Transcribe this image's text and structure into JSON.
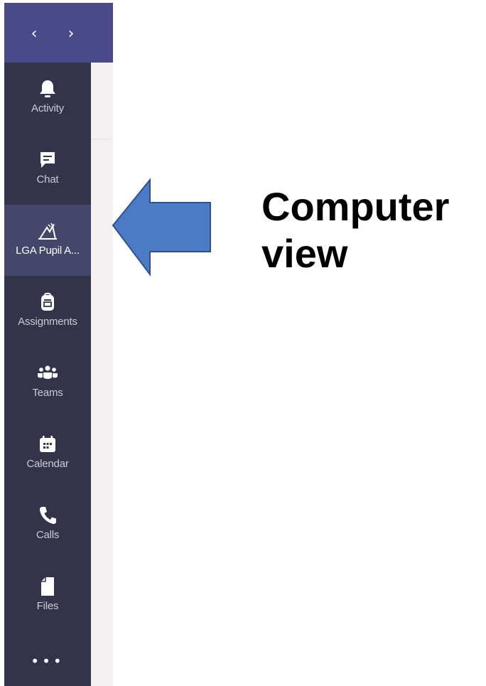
{
  "nav": {
    "back_glyph": "‹",
    "forward_glyph": "›"
  },
  "rail": {
    "items": [
      {
        "label": "Activity",
        "icon": "bell-icon",
        "active": false
      },
      {
        "label": "Chat",
        "icon": "chat-icon",
        "active": false
      },
      {
        "label": "LGA Pupil A...",
        "icon": "school-crest-icon",
        "active": true
      },
      {
        "label": "Assignments",
        "icon": "backpack-icon",
        "active": false
      },
      {
        "label": "Teams",
        "icon": "teams-icon",
        "active": false
      },
      {
        "label": "Calendar",
        "icon": "calendar-icon",
        "active": false
      },
      {
        "label": "Calls",
        "icon": "phone-icon",
        "active": false
      },
      {
        "label": "Files",
        "icon": "file-icon",
        "active": false
      }
    ],
    "more_label": "•••"
  },
  "callout": {
    "line1": "Computer",
    "line2": "view",
    "arrow_icon": "left-arrow-icon",
    "arrow_color": "#4a7bc4"
  },
  "colors": {
    "top_bar": "#4b4a89",
    "rail": "#33344a",
    "rail_active": "#44466a",
    "content_pane": "#f2f1f0"
  }
}
